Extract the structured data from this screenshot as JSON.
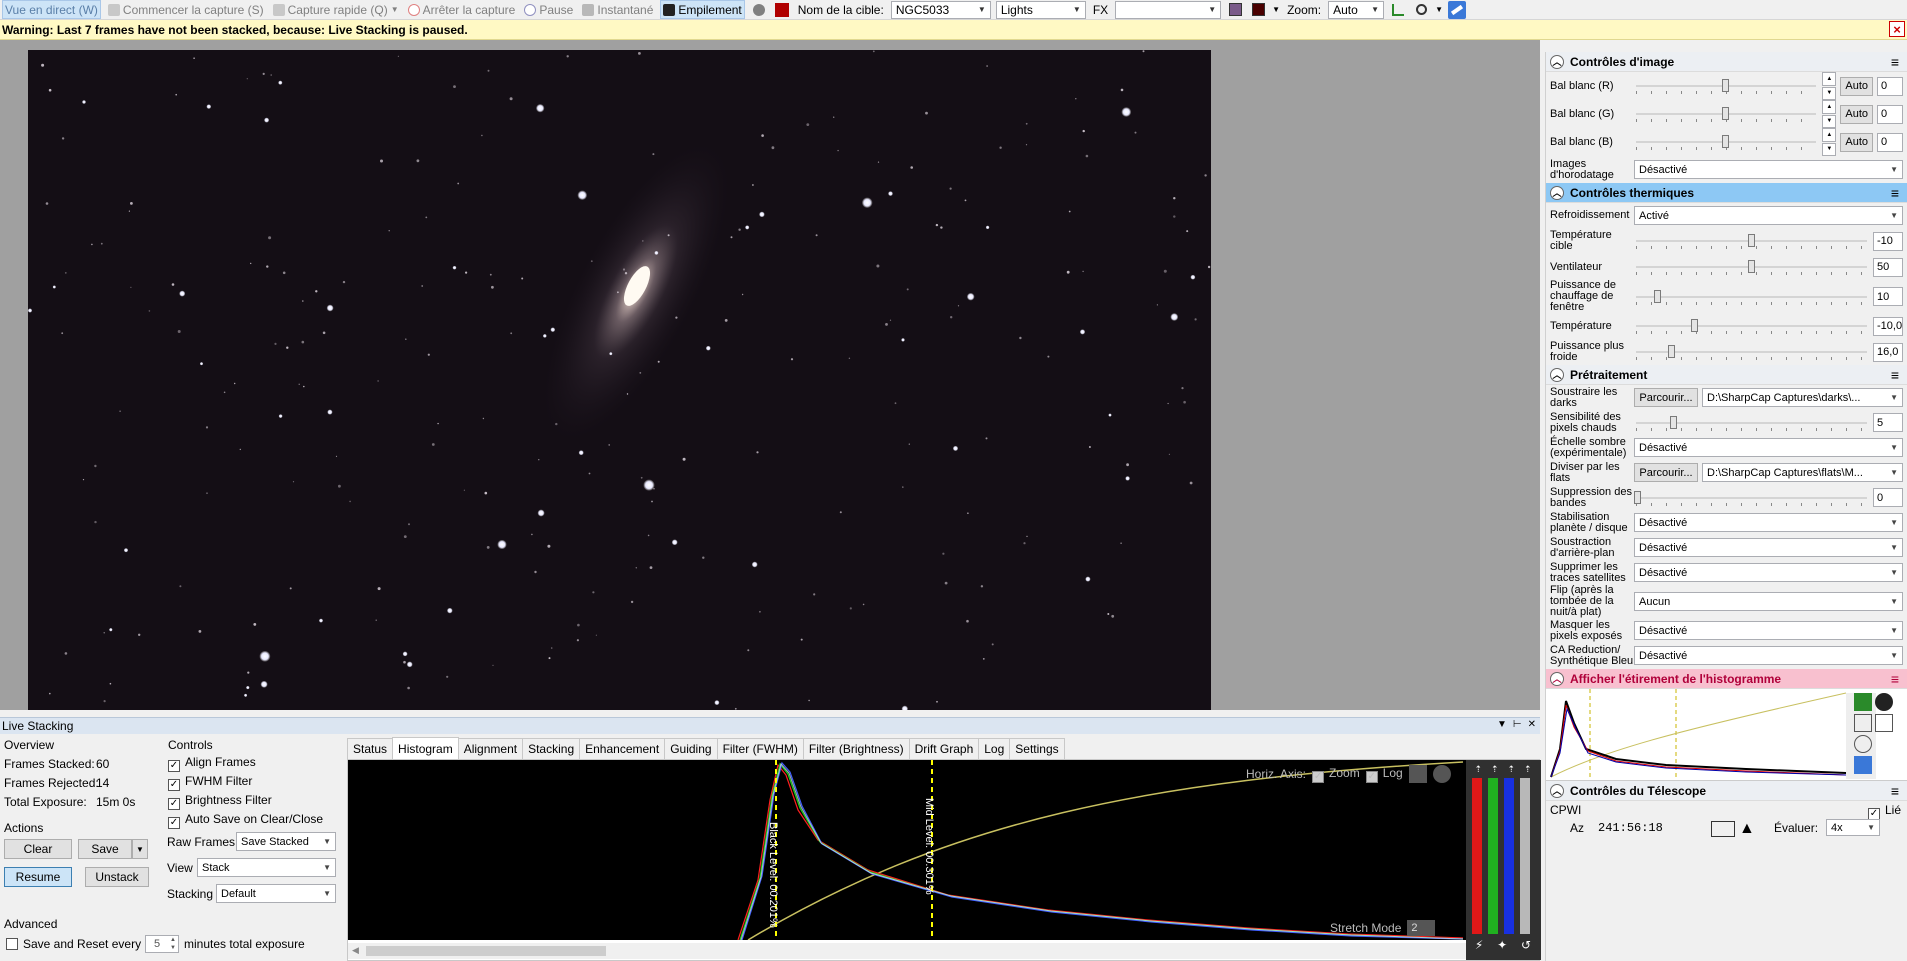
{
  "toolbar": {
    "live_view": "Vue en direct (W)",
    "start_capture": "Commencer la capture (S)",
    "quick_capture": "Capture rapide (Q)",
    "stop_capture": "Arrêter la capture",
    "pause": "Pause",
    "snapshot": "Instantané",
    "stacking": "Empilement",
    "target_name_label": "Nom de la cible:",
    "target_name_value": "NGC5033",
    "frame_type_value": "Lights",
    "fx_label": "FX",
    "fx_value": "",
    "zoom_label": "Zoom:",
    "zoom_value": "Auto"
  },
  "warning": {
    "text": "Warning: Last 7 frames have not been stacked, because: Live Stacking is paused.",
    "close": "×"
  },
  "right_panel": {
    "image_controls": {
      "title": "Contrôles d'image",
      "rows": [
        {
          "label": "Bal blanc (R)",
          "value": "0",
          "auto": "Auto",
          "level": 0.5
        },
        {
          "label": "Bal blanc (G)",
          "value": "0",
          "auto": "Auto",
          "level": 0.5
        },
        {
          "label": "Bal blanc (B)",
          "value": "0",
          "auto": "Auto",
          "level": 0.5
        }
      ],
      "timestamp_label": "Images d'horodatage",
      "timestamp_value": "Désactivé"
    },
    "thermal_controls": {
      "title": "Contrôles thermiques",
      "cooling_label": "Refroidissement",
      "cooling_value": "Activé",
      "rows": [
        {
          "label": "Température cible",
          "value": "-10",
          "level": 0.5
        },
        {
          "label": "Ventilateur",
          "value": "50",
          "level": 0.5
        },
        {
          "label": "Puissance de chauffage de fenêtre",
          "value": "10",
          "level": 0.1
        },
        {
          "label": "Température",
          "value": "-10,0",
          "level": 0.26
        },
        {
          "label": "Puissance plus froide",
          "value": "16,0",
          "level": 0.16
        }
      ]
    },
    "preprocessing": {
      "title": "Prétraitement",
      "dark_label": "Soustraire les darks",
      "browse": "Parcourir...",
      "dark_path": "D:\\SharpCap Captures\\darks\\...",
      "hot_pixels_label": "Sensibilité des pixels chauds",
      "hot_pixels_value": "5",
      "hot_pixels_level": 0.17,
      "dark_scale_label": "Échelle sombre (expérimentale)",
      "dark_scale_value": "Désactivé",
      "flats_label": "Diviser par les flats",
      "flats_path": "D:\\SharpCap Captures\\flats\\M...",
      "banding_label": "Suppression des bandes",
      "banding_value": "0",
      "stabilisation_label": "Stabilisation planète / disque",
      "stabilisation_value": "Désactivé",
      "background_label": "Soustraction d'arrière-plan",
      "background_value": "Désactivé",
      "satellite_label": "Supprimer les traces satellites",
      "satellite_value": "Désactivé",
      "flip_label": "Flip (après la tombée de la nuit/à plat)",
      "flip_value": "Aucun",
      "mask_label": "Masquer les pixels exposés",
      "mask_value": "Désactivé",
      "ca_label": "CA Reduction/ Synthétique Bleu",
      "ca_value": "Désactivé"
    },
    "histogram_stretch": {
      "title": "Afficher l'étirement de l'histogramme"
    },
    "telescope": {
      "title": "Contrôles du Télescope",
      "mount": "CPWI",
      "linked_label": "Lié",
      "az_label": "Az",
      "az_value": "241:56:18",
      "evaluate_label": "Évaluer:",
      "evaluate_value": "4x"
    }
  },
  "live_stacking": {
    "title": "Live Stacking",
    "overview": {
      "title": "Overview",
      "frames_stacked_label": "Frames Stacked:",
      "frames_stacked_value": "60",
      "frames_rejected_label": "Frames Rejected:",
      "frames_rejected_value": "14",
      "total_exposure_label": "Total Exposure:",
      "total_exposure_value": "15m 0s"
    },
    "actions": {
      "title": "Actions",
      "clear": "Clear",
      "save": "Save",
      "resume": "Resume",
      "unstack": "Unstack"
    },
    "advanced": {
      "title": "Advanced",
      "save_reset_label": "Save and Reset every",
      "save_reset_value": "5",
      "save_reset_suffix": "minutes total exposure"
    },
    "controls": {
      "title": "Controls",
      "align_frames": "Align Frames",
      "fwhm_filter": "FWHM Filter",
      "brightness_filter": "Brightness Filter",
      "auto_save": "Auto Save on Clear/Close",
      "raw_frames_label": "Raw Frames",
      "raw_frames_value": "Save Stacked",
      "view_label": "View",
      "view_value": "Stack",
      "stacking_label": "Stacking",
      "stacking_value": "Default"
    },
    "tabs": [
      "Status",
      "Histogram",
      "Alignment",
      "Stacking",
      "Enhancement",
      "Guiding",
      "Filter (FWHM)",
      "Filter (Brightness)",
      "Drift Graph",
      "Log",
      "Settings"
    ],
    "selected_tab": 1,
    "histogram": {
      "horiz_axis_label": "Horiz. Axis:",
      "zoom_label": "Zoom",
      "log_label": "Log",
      "black_level": "Black Level: 00.201%",
      "mid_level": "Mid Level: 00.301%",
      "stretch_mode_label": "Stretch Mode",
      "stretch_mode_value": "2"
    }
  },
  "colors": {
    "accent_blue": "#8dc8f4",
    "warning_bg": "#fff9c4",
    "stretch_pink": "#f8c0cf",
    "sky": "#140e15",
    "black_level_line": "#ffff00"
  }
}
